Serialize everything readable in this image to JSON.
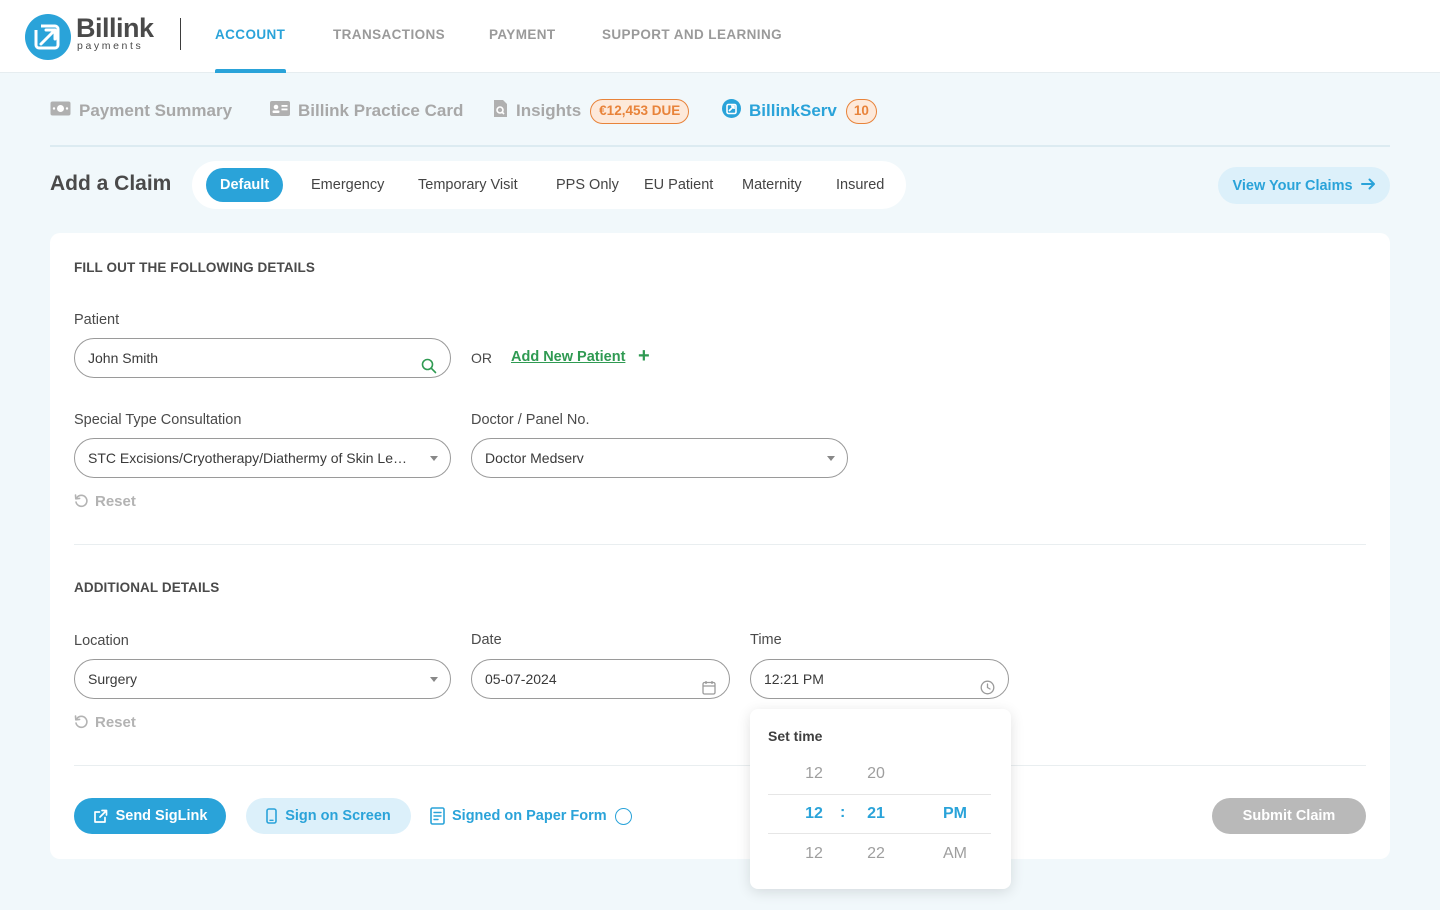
{
  "brand": {
    "name": "Billink",
    "tagline": "payments"
  },
  "topnav": [
    {
      "label": "ACCOUNT",
      "active": true
    },
    {
      "label": "TRANSACTIONS"
    },
    {
      "label": "PAYMENT"
    },
    {
      "label": "SUPPORT AND LEARNING"
    }
  ],
  "subnav": {
    "payment_summary": "Payment Summary",
    "practice_card": "Billink Practice Card",
    "insights": "Insights",
    "insights_badge": "€12,453 DUE",
    "billinkserv": "BillinkServ",
    "billinkserv_badge": "10"
  },
  "claim": {
    "title": "Add a Claim",
    "tabs": [
      "Default",
      "Emergency",
      "Temporary Visit",
      "PPS Only",
      "EU Patient",
      "Maternity",
      "Insured"
    ],
    "active_tab": "Default",
    "view_claims": "View Your Claims"
  },
  "form": {
    "section1_title": "FILL OUT THE FOLLOWING DETAILS",
    "patient_label": "Patient",
    "patient_value": "John Smith",
    "or_text": "OR",
    "add_new_patient": "Add New Patient",
    "stc_label": "Special Type Consultation",
    "stc_value": "STC Excisions/Cryotherapy/Diathermy of Skin Lesions",
    "doctor_label": "Doctor / Panel No.",
    "doctor_value": "Doctor Medserv",
    "reset": "Reset",
    "section2_title": "ADDITIONAL DETAILS",
    "location_label": "Location",
    "location_value": "Surgery",
    "date_label": "Date",
    "date_value": "05-07-2024",
    "time_label": "Time",
    "time_value": "12:21 PM"
  },
  "actions": {
    "send_siglink": "Send SigLink",
    "sign_on_screen": "Sign on Screen",
    "signed_paper": "Signed on Paper Form",
    "submit_claim": "Submit Claim"
  },
  "timepicker": {
    "title": "Set time",
    "hours_prev": "12",
    "minutes_prev": "20",
    "hours": "12",
    "separator": ":",
    "minutes": "21",
    "meridiem": "PM",
    "hours_next": "12",
    "minutes_next": "22",
    "meridiem_next": "AM"
  },
  "colors": {
    "accent": "#2aa3d9",
    "success": "#2f9a52",
    "warning": "#e8833a",
    "background": "#f1f8fb"
  }
}
